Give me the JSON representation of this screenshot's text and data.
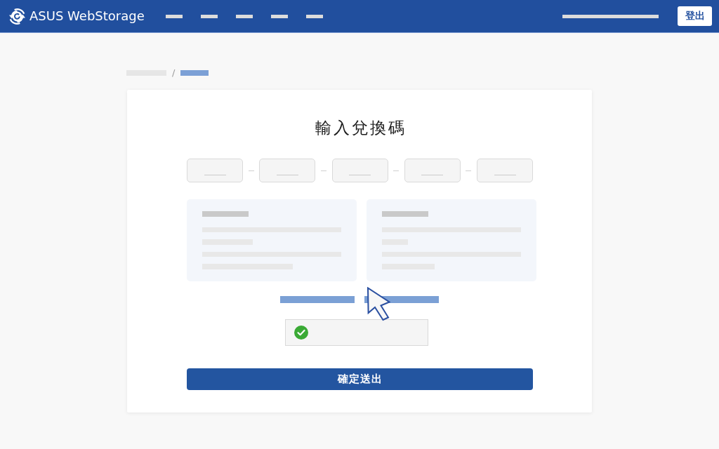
{
  "header": {
    "brand": "ASUS WebStorage",
    "nav_items": [
      {
        "kind": "placeholder"
      },
      {
        "kind": "placeholder"
      },
      {
        "kind": "placeholder"
      },
      {
        "kind": "placeholder"
      },
      {
        "kind": "placeholder"
      }
    ],
    "account": {
      "kind": "placeholder"
    },
    "logout_button": "登出"
  },
  "breadcrumb": {
    "separator": "/",
    "items": [
      {
        "kind": "placeholder",
        "selected": false
      },
      {
        "kind": "placeholder",
        "selected": true
      }
    ]
  },
  "redeem_form": {
    "title": "輸入兌換碼",
    "code_fields": [
      {
        "kind": "blank"
      },
      {
        "kind": "blank"
      },
      {
        "kind": "blank"
      },
      {
        "kind": "blank"
      },
      {
        "kind": "blank"
      }
    ],
    "option_cards": [
      {
        "kind": "placeholder"
      },
      {
        "kind": "placeholder"
      }
    ],
    "links": [
      {
        "kind": "placeholder"
      },
      {
        "kind": "placeholder"
      }
    ],
    "verification": {
      "checked": true
    },
    "submit_button": "確定送出"
  }
}
